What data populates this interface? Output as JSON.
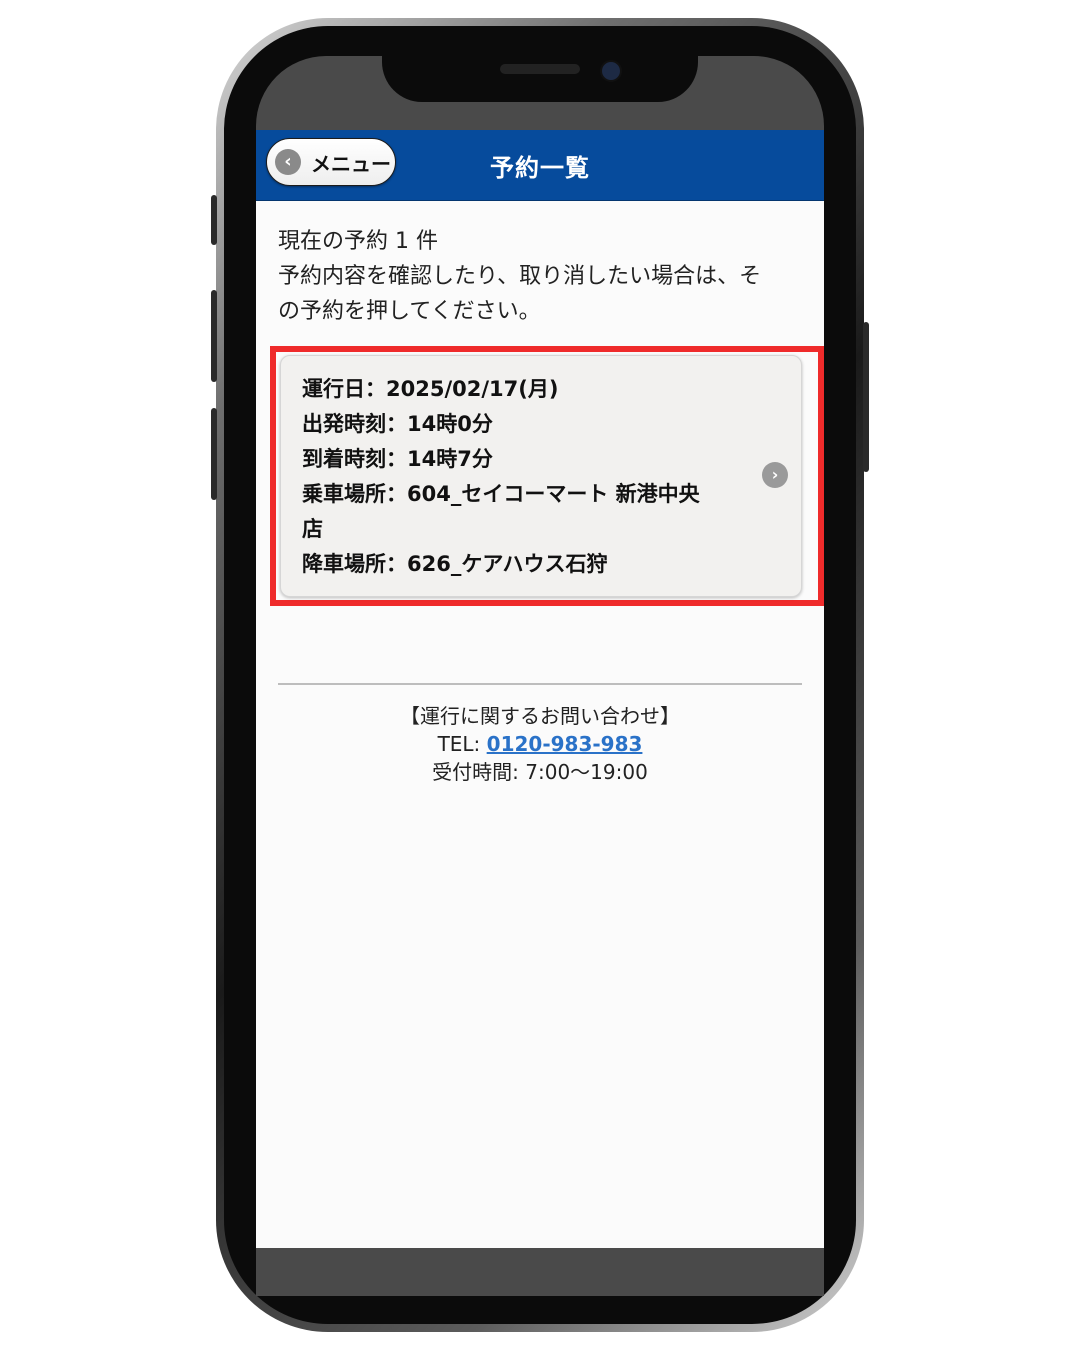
{
  "header": {
    "menu_label": "メニュー",
    "menu_icon": "chevron-left-icon",
    "title": "予約一覧",
    "bar_color": "#064b9c"
  },
  "intro": {
    "lines": [
      "現在の予約 1 件",
      "予約内容を確認したり、取り消したい場合は、そ",
      "の予約を押してください。"
    ]
  },
  "reservation": {
    "lines": [
      "運行日：2025/02/17(月)",
      "出発時刻：14時0分",
      "到着時刻：14時7分",
      "乗車場所：604_セイコーマート 新港中央",
      "店",
      "降車場所：626_ケアハウス石狩"
    ],
    "chevron_icon": "chevron-right-icon",
    "highlight_color": "#ef2b2b"
  },
  "contact": {
    "heading": "【運行に関するお問い合わせ】",
    "tel_label": "TEL: ",
    "tel_number": "0120-983-983",
    "hours": "受付時間: 7:00〜19:00",
    "link_color": "#2a72c8"
  }
}
